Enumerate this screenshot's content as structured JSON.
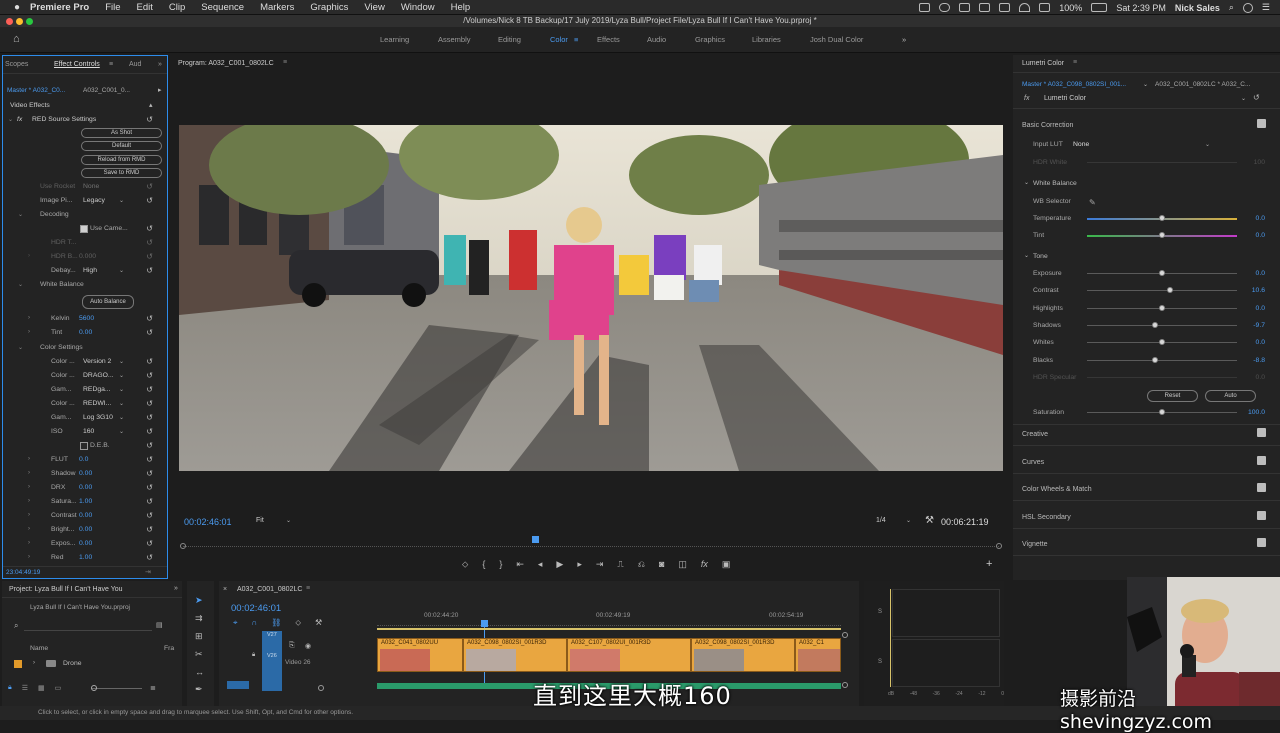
{
  "menubar": {
    "app": "Premiere Pro",
    "items": [
      "File",
      "Edit",
      "Clip",
      "Sequence",
      "Markers",
      "Graphics",
      "View",
      "Window",
      "Help"
    ],
    "battery": "100%",
    "clock": "Sat 2:39 PM",
    "user": "Nick Sales"
  },
  "titlebar": {
    "path": "/Volumes/Nick 8 TB Backup/17 July 2019/Lyza Bull/Project File/Lyza Bull If I Can't Have You.prproj *"
  },
  "workspaces": {
    "items": [
      "Learning",
      "Assembly",
      "Editing",
      "Color",
      "Effects",
      "Audio",
      "Graphics",
      "Libraries",
      "Josh Dual Color"
    ],
    "active": "Color",
    "more": "»"
  },
  "effect_controls": {
    "tabs": [
      "Scopes",
      "Effect Controls",
      "Aud"
    ],
    "master": "Master * A032_C0...",
    "clip": "A032_C001_0...",
    "video_effects": "Video Effects",
    "red_source": "RED Source Settings",
    "buttons": [
      "As Shot",
      "Default",
      "Reload from RMD",
      "Save to RMD"
    ],
    "use_rocket": {
      "label": "Use Rocket",
      "value": "None"
    },
    "image_pipeline": {
      "label": "Image Pi...",
      "value": "Legacy"
    },
    "decoding": "Decoding",
    "use_camera": "Use Came...",
    "hdr_t": "HDR T...",
    "hdr_b": {
      "label": "HDR B...",
      "value": "0.000"
    },
    "debayer": {
      "label": "Debay...",
      "value": "High"
    },
    "white_balance": "White Balance",
    "auto_balance": "Auto Balance",
    "kelvin": {
      "label": "Kelvin",
      "value": "5600"
    },
    "tint": {
      "label": "Tint",
      "value": "0.00"
    },
    "color_settings": "Color Settings",
    "color_rows": [
      {
        "label": "Color ...",
        "value": "Version 2"
      },
      {
        "label": "Color ...",
        "value": "DRAGO..."
      },
      {
        "label": "Gam...",
        "value": "REDga..."
      },
      {
        "label": "Color ...",
        "value": "REDWI..."
      },
      {
        "label": "Gam...",
        "value": "Log 3G10"
      },
      {
        "label": "ISO",
        "value": "160"
      }
    ],
    "deb": "D.E.B.",
    "num_rows": [
      {
        "label": "FLUT",
        "value": "0.0"
      },
      {
        "label": "Shadow",
        "value": "0.00"
      },
      {
        "label": "DRX",
        "value": "0.00"
      },
      {
        "label": "Satura...",
        "value": "1.00"
      },
      {
        "label": "Contrast",
        "value": "0.00"
      },
      {
        "label": "Bright...",
        "value": "0.00"
      },
      {
        "label": "Expos...",
        "value": "0.00"
      },
      {
        "label": "Red",
        "value": "1.00"
      }
    ],
    "timecode": "23:04:49:19"
  },
  "program": {
    "title": "Program: A032_C001_0802LC",
    "timecode": "00:02:46:01",
    "fit": "Fit",
    "resolution": "1/4",
    "duration": "00:06:21:19"
  },
  "lumetri": {
    "title": "Lumetri Color",
    "master": "Master * A032_C098_0802SI_001...",
    "clip": "A032_C001_0802LC * A032_C...",
    "fx": "Lumetri Color",
    "basic_correction": "Basic Correction",
    "input_lut": {
      "label": "Input LUT",
      "value": "None"
    },
    "hdr_white": {
      "label": "HDR White",
      "value": "100"
    },
    "white_balance": "White Balance",
    "wb_selector": "WB Selector",
    "temperature": {
      "label": "Temperature",
      "value": "0.0"
    },
    "tint": {
      "label": "Tint",
      "value": "0.0"
    },
    "tone": "Tone",
    "tone_rows": [
      {
        "label": "Exposure",
        "value": "0.0",
        "pos": 0.5
      },
      {
        "label": "Contrast",
        "value": "10.6",
        "pos": 0.555
      },
      {
        "label": "Highlights",
        "value": "0.0",
        "pos": 0.5
      },
      {
        "label": "Shadows",
        "value": "-9.7",
        "pos": 0.45
      },
      {
        "label": "Whites",
        "value": "0.0",
        "pos": 0.5
      },
      {
        "label": "Blacks",
        "value": "-8.8",
        "pos": 0.455
      }
    ],
    "hdr_specular": {
      "label": "HDR Specular",
      "value": "0.0"
    },
    "reset": "Reset",
    "auto": "Auto",
    "saturation": {
      "label": "Saturation",
      "value": "100.0"
    },
    "sections": [
      "Creative",
      "Curves",
      "Color Wheels & Match",
      "HSL Secondary",
      "Vignette"
    ]
  },
  "project": {
    "title": "Project: Lyza Bull If I Can't Have You",
    "file": "Lyza Bull If I Can't Have You.prproj",
    "col_name": "Name",
    "col_fr": "Fra",
    "item": "Drone"
  },
  "timeline": {
    "tab": "A032_C001_0802LC",
    "timecode": "00:02:46:01",
    "ticks": [
      "00:02:44:20",
      "00:02:49:19",
      "00:02:54:19"
    ],
    "track_v27": "V27",
    "track_v26": "V26",
    "track_label": "Video 26",
    "clips": [
      "A032_C041_0802UU",
      "A032_C098_0802SI_001R3D",
      "A032_C107_0802UI_001R3D",
      "A032_C098_0802SI_001R3D",
      "A032_C1"
    ]
  },
  "meter": {
    "s1": "S",
    "s2": "S",
    "labels": [
      "dB",
      "-48",
      "-36",
      "-24",
      "-12",
      "0"
    ]
  },
  "status": "Click to select, or click in empty space and drag to marquee select. Use Shift, Opt, and Cmd for other options.",
  "subtitle": "直到这里大概160",
  "watermark": "摄影前沿shevingzyz.com",
  "accent": "#4b9bf0",
  "clip_color": "#e9a640"
}
